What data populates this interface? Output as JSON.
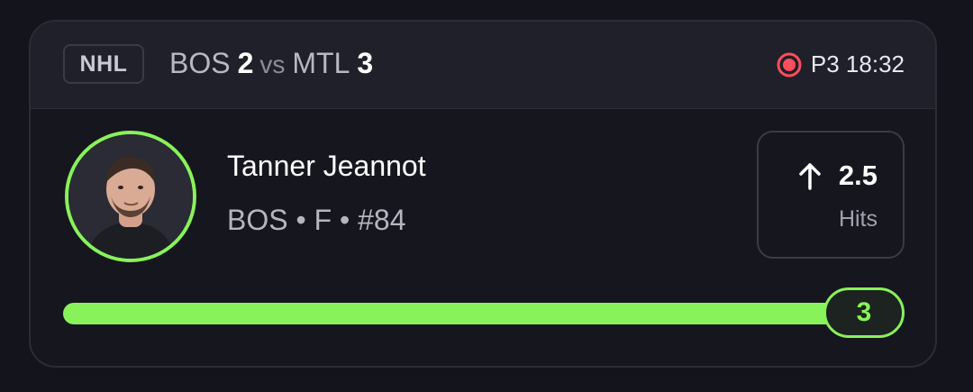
{
  "header": {
    "league": "NHL",
    "home_team": "BOS",
    "home_score": "2",
    "vs": "vs",
    "away_team": "MTL",
    "away_score": "3",
    "live_icon": "live-record-icon",
    "period_clock": "P3 18:32"
  },
  "player": {
    "avatar_icon": "player-photo",
    "name": "Tanner Jeannot",
    "meta": "BOS • F • #84"
  },
  "prop": {
    "direction_icon": "arrow-up-icon",
    "line": "2.5",
    "stat": "Hits"
  },
  "progress": {
    "current": "3",
    "fraction": 1.0
  },
  "colors": {
    "accent": "#88f25a",
    "live": "#ff4d5b",
    "background": "#14141d",
    "header_bg": "#1f2029"
  }
}
